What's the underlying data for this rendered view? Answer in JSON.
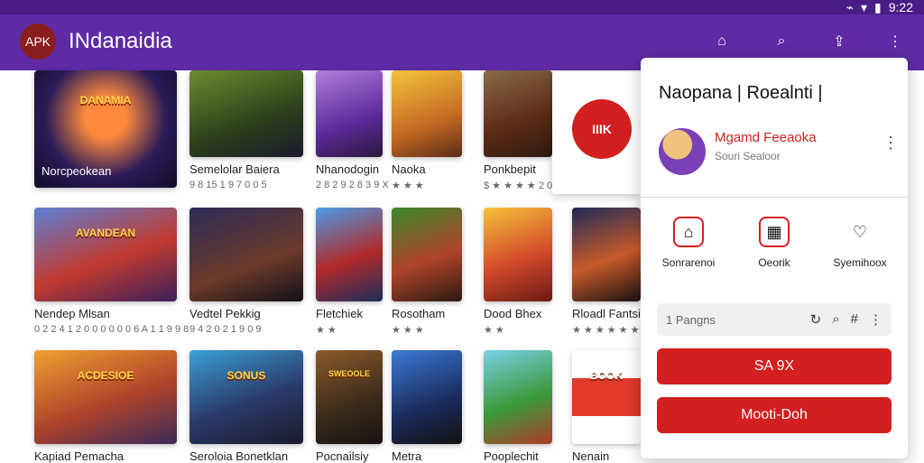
{
  "status_bar": {
    "time": "9:22"
  },
  "app_bar": {
    "logo_text": "APK",
    "title": "INdanaidia",
    "icons": [
      "home-icon",
      "search-icon",
      "share-icon",
      "more-vert-icon"
    ]
  },
  "games": [
    {
      "title": "Norcpeokean",
      "subtitle": ""
    },
    {
      "title": "Semelolar Baiera",
      "subtitle": "9 8 15 1 9 7 0 0 5"
    },
    {
      "title": "Nhanodogin",
      "subtitle": "2 8 2 9 2 8 3 9 X"
    },
    {
      "title": "Naoka",
      "subtitle": "★ ★ ★"
    },
    {
      "title": "Ponkbepit",
      "subtitle": "$ ★ ★ ★ ★ 2 0 0 1"
    },
    {
      "title": "Nendep Mlsan",
      "subtitle": "0 2 2 4 1 2 0 0 0 0 0 0 6 A 1 1 9 9 8"
    },
    {
      "title": "Vedtel Pekkig",
      "subtitle": "9 4 2 0 2 1 9 0 9"
    },
    {
      "title": "Fletchiek",
      "subtitle": "★ ★"
    },
    {
      "title": "Rosotham",
      "subtitle": "★ ★ ★"
    },
    {
      "title": "Dood Bhex",
      "subtitle": "★ ★"
    },
    {
      "title": "Rloadl Fantsi",
      "subtitle": "★ ★ ★ ★ ★ ★"
    },
    {
      "title": "Kapiad Pemacha",
      "subtitle": ""
    },
    {
      "title": "Seroloia Bonetklan",
      "subtitle": ""
    },
    {
      "title": "Pocnailsiy",
      "subtitle": ""
    },
    {
      "title": "Metra",
      "subtitle": ""
    },
    {
      "title": "Pooplechit",
      "subtitle": ""
    },
    {
      "title": "Nenain",
      "subtitle": ""
    }
  ],
  "thumb_texts": [
    "DANAMIA",
    "",
    "",
    "",
    "",
    "AVANDEAN",
    "",
    "",
    "",
    "",
    "",
    "ACDESIOE",
    "SONUS",
    "SWEOOLE",
    "",
    "",
    "BOOK"
  ],
  "ad": {
    "label": "IIIK"
  },
  "panel": {
    "title": "Naopana | Roealnti |",
    "profile": {
      "name": "Mgamd Feeaoka",
      "subtitle": "Souri Sealoor"
    },
    "actions": [
      {
        "label": "Sonrarenoi",
        "icon": "bag-icon"
      },
      {
        "label": "Oeorik",
        "icon": "grid-icon"
      },
      {
        "label": "Syemihoox",
        "icon": "heart-icon"
      }
    ],
    "search": {
      "placeholder": "1 Pangns"
    },
    "buttons": {
      "primary": "SA 9X",
      "secondary": "Mooti-Doh"
    }
  },
  "colors": {
    "status_bar": "#4a1d86",
    "app_bar": "#5e2aa5",
    "accent_red": "#d31f1f"
  }
}
